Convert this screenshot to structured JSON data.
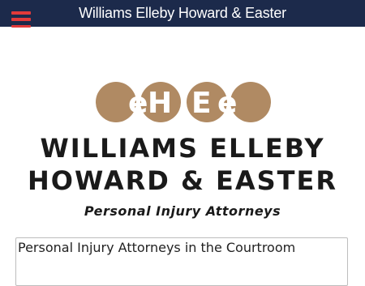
{
  "header": {
    "site_title": "Williams Elleby Howard & Easter",
    "background": "#1c2a4b",
    "menu_icon_color": "#e23a3a"
  },
  "logo": {
    "monogram": "eHEe",
    "initials": [
      "e",
      "H",
      "E",
      "e"
    ],
    "color": "#b08a63"
  },
  "firm": {
    "name_line1": "WILLIAMS ELLEBY",
    "name_line2": "HOWARD & EASTER",
    "tagline": "Personal Injury Attorneys"
  },
  "content": {
    "title": "Personal Injury Attorneys in the Courtroom"
  }
}
